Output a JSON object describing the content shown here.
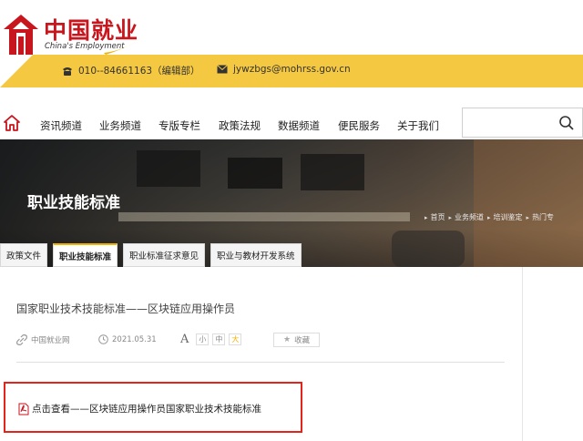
{
  "header": {
    "logo_cn": "中国就业",
    "logo_en": "China's Employment",
    "phone_icon": "phone-icon",
    "phone": "010--84661163（编辑部）",
    "mail_icon": "envelope-icon",
    "email": "jywzbgs@mohrss.gov.cn"
  },
  "nav": {
    "home_icon": "home-icon",
    "items": [
      "资讯频道",
      "业务频道",
      "专版专栏",
      "政策法规",
      "数据频道",
      "便民服务",
      "关于我们"
    ],
    "search_icon": "search-icon"
  },
  "banner": {
    "title": "职业技能标准",
    "breadcrumbs": [
      "首页",
      "业务频道",
      "培训鉴定",
      "热门专"
    ]
  },
  "tabs": {
    "items": [
      "政策文件",
      "职业技能标准",
      "职业标准征求意见",
      "职业与教材开发系统"
    ],
    "active": "职业技能标准"
  },
  "article": {
    "title": "国家职业技术技能标准——区块链应用操作员",
    "source_icon": "link-icon",
    "source": "中国就业网",
    "date_icon": "clock-icon",
    "date": "2021.05.31",
    "font_label": "A",
    "font_sizes": [
      "小",
      "中",
      "大"
    ],
    "favorite_icon": "star-icon",
    "favorite_label": "收藏",
    "attachment_icon": "pdf-icon",
    "attachment_text": "点击查看——区块链应用操作员国家职业技术技能标准"
  },
  "colors": {
    "brand_red": "#c8161e",
    "accent_yellow": "#f5c842",
    "highlight_red": "#e2241c"
  }
}
